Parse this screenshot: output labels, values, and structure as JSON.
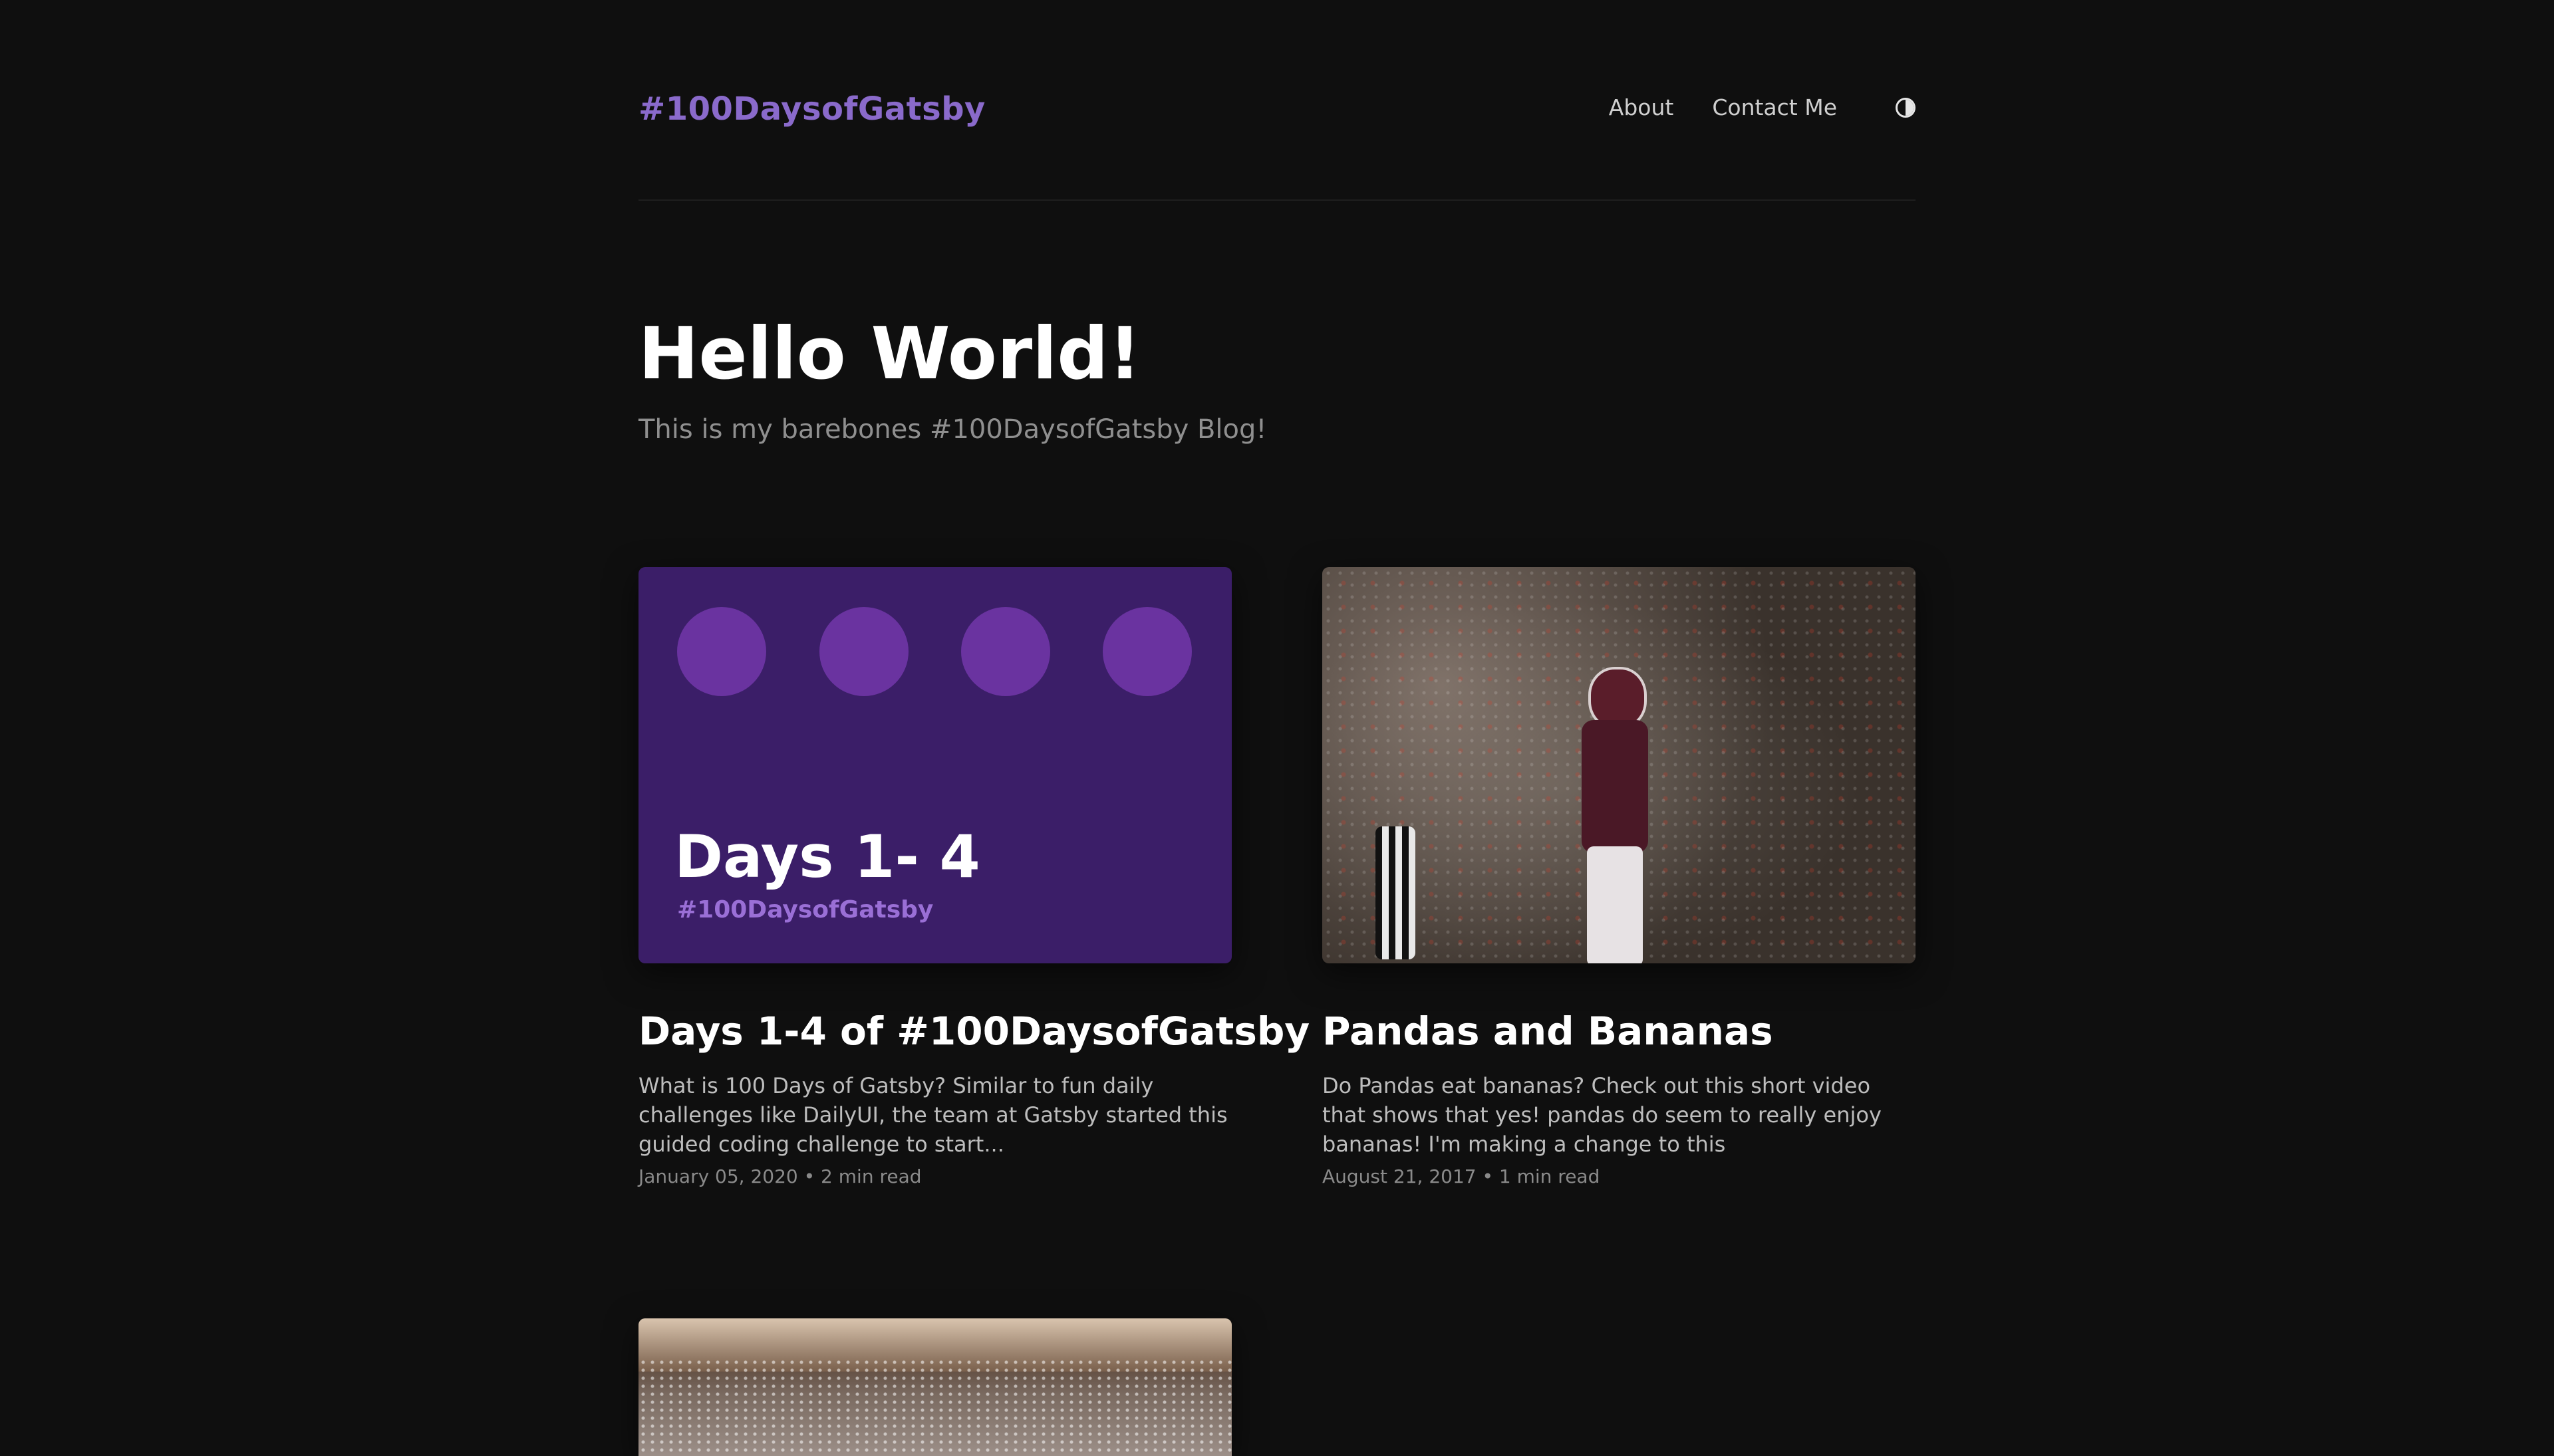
{
  "header": {
    "brand": "#100DaysofGatsby",
    "nav": {
      "about": "About",
      "contact": "Contact Me"
    },
    "theme_toggle_icon": "half-circle-contrast-icon"
  },
  "hero": {
    "title": "Hello World!",
    "subtitle": "This is my barebones #100DaysofGatsby Blog!"
  },
  "posts": [
    {
      "thumbnail": {
        "kind": "graphic",
        "title": "Days 1- 4",
        "tag": "#100DaysofGatsby",
        "bg_color": "#3b1e68",
        "dot_color": "#6a33a0"
      },
      "title": "Days 1-4 of #100DaysofGatsby",
      "excerpt": "What is 100 Days of Gatsby? Similar to fun daily challenges like DailyUI, the team at Gatsby started this guided coding challenge to start...",
      "meta": "January 05, 2020 • 2 min read"
    },
    {
      "thumbnail": {
        "kind": "photo",
        "subject": "football-player-photo"
      },
      "title": "Pandas and Bananas",
      "excerpt": "Do Pandas eat bananas? Check out this short video that shows that yes! pandas do seem to really enjoy bananas! I'm making a change to this",
      "meta": "August 21, 2017 • 1 min read"
    },
    {
      "thumbnail": {
        "kind": "photo",
        "subject": "stadium-crowd-photo"
      }
    }
  ],
  "colors": {
    "background": "#0f0f0f",
    "brand": "#8a6acb",
    "muted_text": "#8f8f8f"
  }
}
